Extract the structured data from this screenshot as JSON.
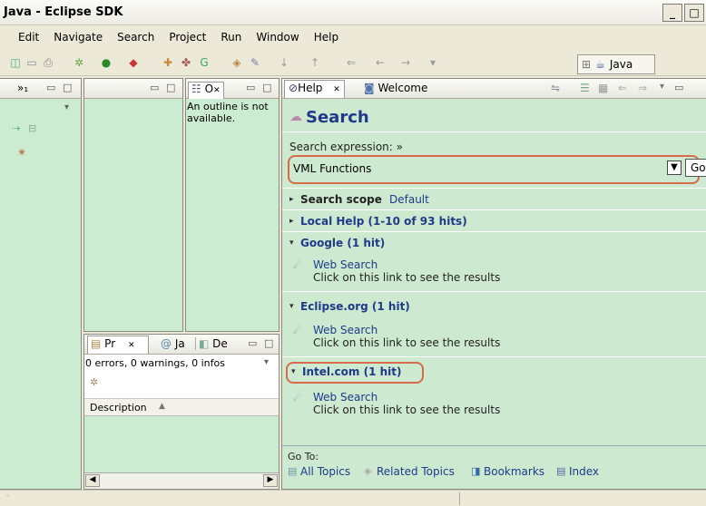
{
  "window": {
    "title": "Java - Eclipse SDK",
    "min": "_",
    "max": "□"
  },
  "menu": [
    "Edit",
    "Navigate",
    "Search",
    "Project",
    "Run",
    "Window",
    "Help"
  ],
  "perspective": {
    "label": "Java"
  },
  "leftPanel": {
    "tab": "»₁"
  },
  "outline": {
    "tab": "O",
    "message": "An outline is not available."
  },
  "problems": {
    "tabs": [
      "Pr",
      "Ja",
      "De"
    ],
    "summary": "0 errors, 0 warnings, 0 infos",
    "column": "Description"
  },
  "help": {
    "tabs": [
      "Help",
      "Welcome"
    ],
    "heading": "Search",
    "expressionLabel": "Search expression: »",
    "query": "VML Functions",
    "go": "Go",
    "scopeLabel": "Search scope",
    "scopeValue": "Default",
    "groups": [
      {
        "title": "Local Help (1-10 of 93 hits)"
      },
      {
        "title": "Google (1 hit)",
        "link": "Web Search",
        "desc": "Click on this link to see the results"
      },
      {
        "title": "Eclipse.org  (1 hit)",
        "link": "Web Search",
        "desc": "Click on this link to see the results"
      },
      {
        "title": "Intel.com (1 hit)",
        "link": "Web Search",
        "desc": "Click on this link to see the results"
      }
    ],
    "gotoLabel": "Go To:",
    "goto": [
      "All Topics",
      "Related Topics",
      "Bookmarks",
      "Index"
    ]
  }
}
